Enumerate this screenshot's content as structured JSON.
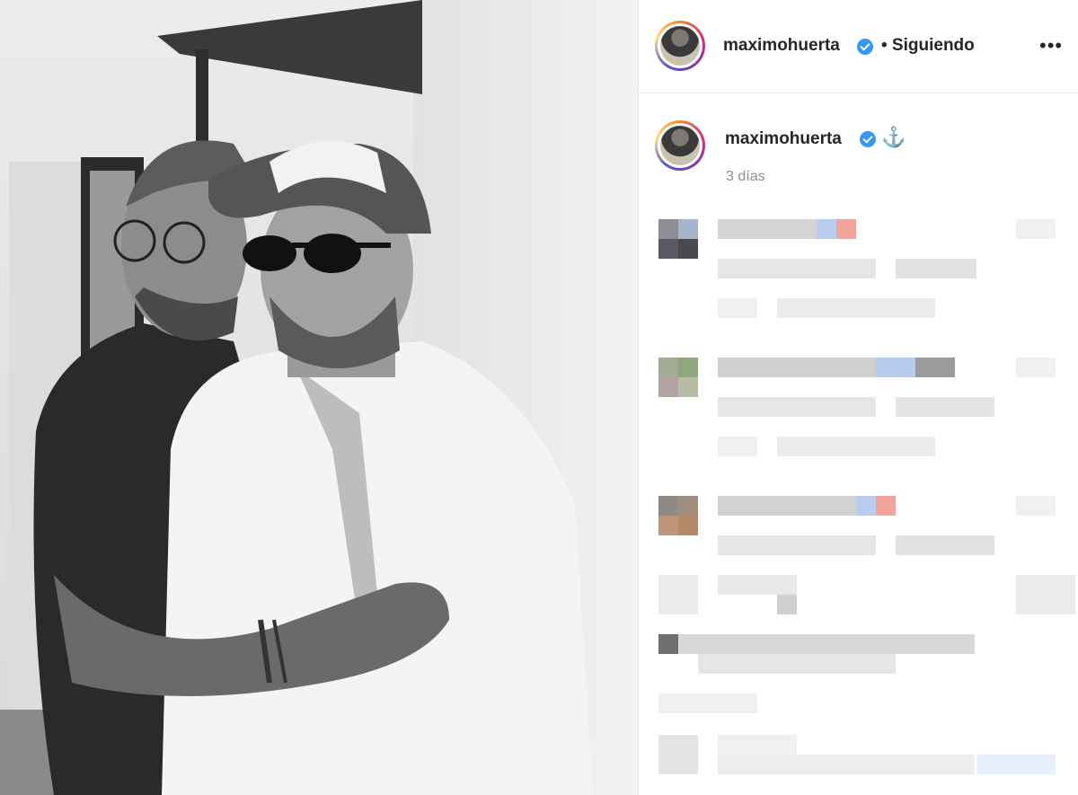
{
  "post": {
    "author": "maximohuerta",
    "follow_label": "• Siguiendo",
    "more_icon": "more-options-icon",
    "verified_icon": "verified-badge-icon"
  },
  "caption": {
    "author": "maximohuerta",
    "emoji": "⚓",
    "time_ago": "3 días"
  },
  "more_glyph": "•••",
  "colors": {
    "verified": "#3897f0",
    "text": "#262626",
    "muted": "#8e8e8e"
  }
}
